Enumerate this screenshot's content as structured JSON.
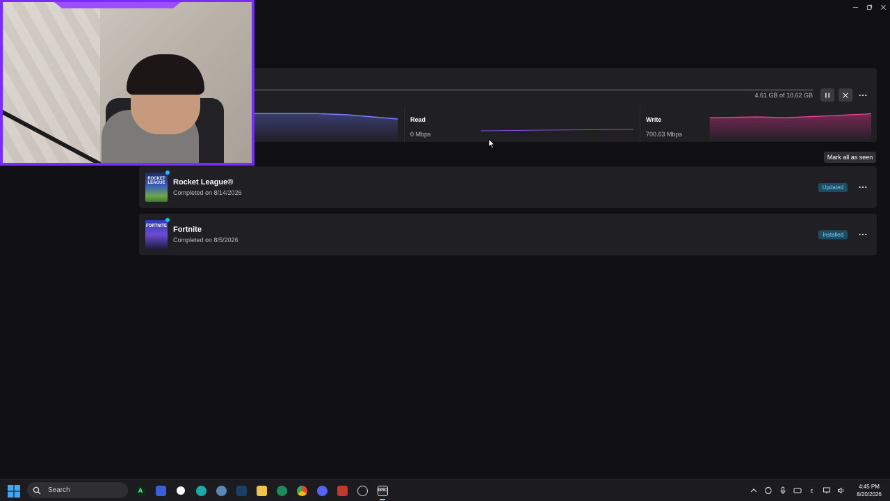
{
  "window_controls": {
    "minimize": "–",
    "restore": "❐",
    "close": "✕"
  },
  "download": {
    "progress_percent": 11.0,
    "size_text": "4.61 GB of 10.62 GB",
    "stats": {
      "read_label": "Read",
      "read_value": "0 Mbps",
      "write_label": "Write",
      "write_value": "700.63 Mbps"
    }
  },
  "mark_all_label": "Mark all as seen",
  "games": [
    {
      "title": "Rocket League®",
      "subtitle": "Completed on 8/14/2026",
      "status": "Updated",
      "thumb_text": "ROCKET LEAGUE"
    },
    {
      "title": "Fortnite",
      "subtitle": "Completed on 8/5/2026",
      "status": "Installed",
      "thumb_text": "FORTNITE"
    }
  ],
  "taskbar": {
    "search_label": "Search",
    "tray_lang": "ε",
    "clock_time": "4:45 PM",
    "clock_date": "8/20/2026"
  },
  "colors": {
    "background": "#101014",
    "panel": "#202024",
    "accent_blue": "#26bbff",
    "webcam_border": "#7a2cff",
    "write_graph": "#e0338f",
    "net_graph": "#6b73ff"
  },
  "icons": [
    "start-icon",
    "search-icon",
    "terminal-icon",
    "copilot-icon",
    "edge-icon",
    "settings-icon",
    "steam-icon",
    "folder-icon",
    "app-icon",
    "chrome-icon",
    "discord-icon",
    "game-icon",
    "clock-app-icon",
    "epic-games-icon"
  ]
}
